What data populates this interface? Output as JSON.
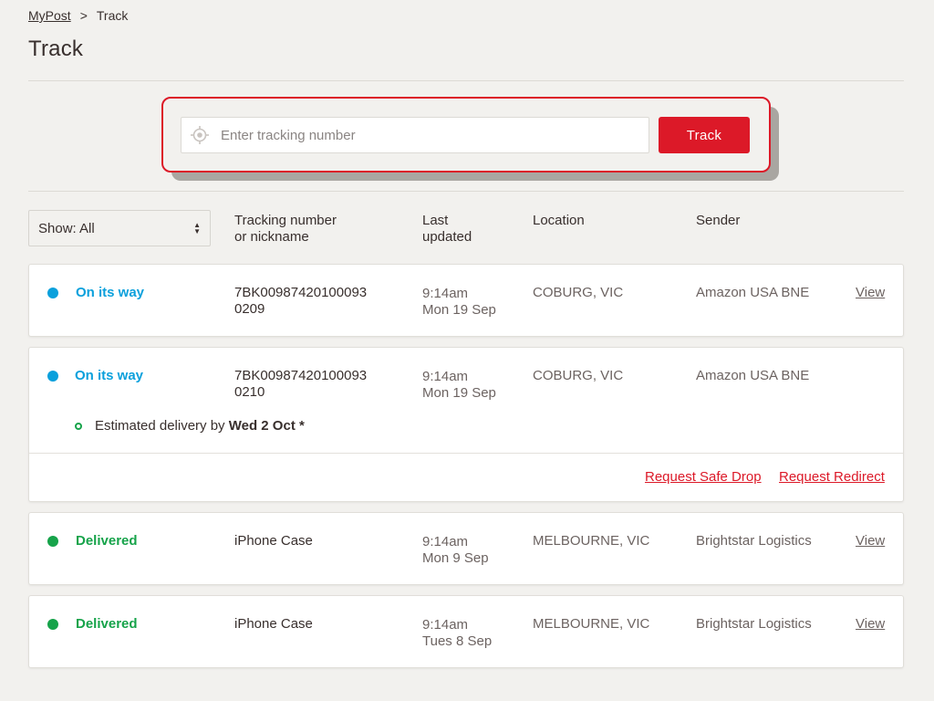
{
  "breadcrumb": {
    "home": "MyPost",
    "separator": ">",
    "current": "Track"
  },
  "page": {
    "title": "Track"
  },
  "search": {
    "placeholder": "Enter tracking number",
    "button": "Track",
    "icon": "location-target-icon"
  },
  "filter": {
    "label": "Show: All"
  },
  "columns": {
    "tracking": "Tracking number\nor nickname",
    "updated": "Last\nupdated",
    "location": "Location",
    "sender": "Sender"
  },
  "colors": {
    "accent": "#dc1928",
    "on_its_way": "#0aa0dc",
    "delivered": "#16a34a"
  },
  "shipments": [
    {
      "status": "On its way",
      "tracking": "7BK00987420100093\n0209",
      "time": "9:14am",
      "date": "Mon 19 Sep",
      "location": "COBURG, VIC",
      "sender": "Amazon USA BNE",
      "action": "View"
    },
    {
      "status": "On its way",
      "tracking": "7BK00987420100093\n0210",
      "time": "9:14am",
      "date": "Mon 19 Sep",
      "location": "COBURG, VIC",
      "sender": "Amazon USA BNE",
      "estimate_prefix": "Estimated delivery by",
      "estimate_date": "Wed 2 Oct *",
      "link_safe_drop": "Request Safe Drop",
      "link_redirect": "Request Redirect"
    },
    {
      "status": "Delivered",
      "tracking": "iPhone Case",
      "time": "9:14am",
      "date": "Mon 9 Sep",
      "location": "MELBOURNE, VIC",
      "sender": "Brightstar Logistics",
      "action": "View"
    },
    {
      "status": "Delivered",
      "tracking": "iPhone Case",
      "time": "9:14am",
      "date": "Tues 8 Sep",
      "location": "MELBOURNE, VIC",
      "sender": "Brightstar Logistics",
      "action": "View"
    }
  ]
}
